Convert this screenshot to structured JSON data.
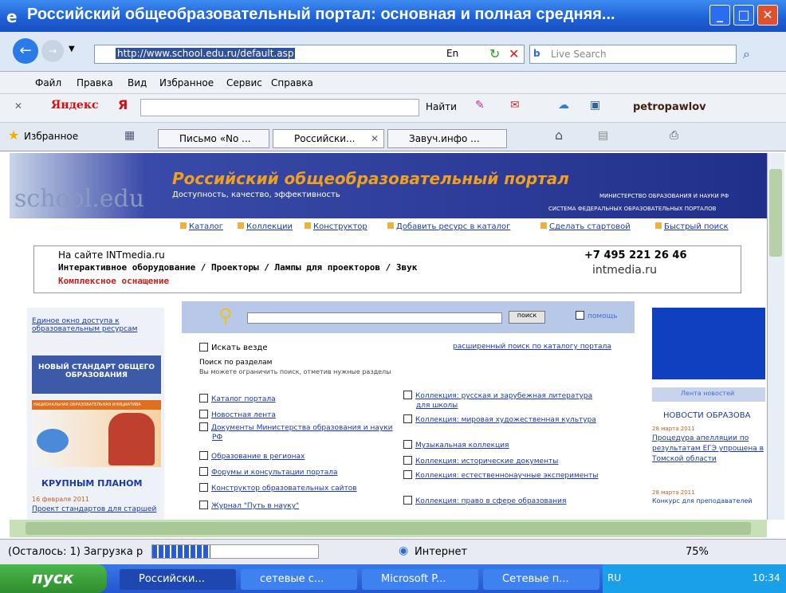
{
  "window": {
    "title": "Российский общеобразовательный портал: основная и полная средняя..."
  },
  "nav": {
    "url": "http://www.school.edu.ru/default.asp",
    "search_placeholder": "Live Search",
    "lang": "En"
  },
  "menu": [
    "Файл",
    "Правка",
    "Вид",
    "Избранное",
    "Сервис",
    "Справка"
  ],
  "yandex": {
    "logo": "Яндекс",
    "find": "Найти",
    "user": "petropawlov"
  },
  "tabs": {
    "favorites": "Избранное",
    "items": [
      "Письмо «No ...",
      "Российски...",
      "Завуч.инфо ..."
    ]
  },
  "banner": {
    "title": "Российский общеобразовательный портал",
    "subtitle": "Доступность, качество, эффективность",
    "ministry": "МИНИСТЕРСТВО ОБРАЗОВАНИЯ И НАУКИ РФ",
    "system": "СИСТЕМА ФЕДЕРАЛЬНЫХ ОБРАЗОВАТЕЛЬНЫХ ПОРТАЛОВ",
    "watermark": "school.edu"
  },
  "toplinks": [
    "Каталог",
    "Коллекции",
    "Конструктор",
    "Добавить ресурс в каталог",
    "Сделать стартовой",
    "Быстрый поиск"
  ],
  "ad": {
    "line1": "На сайте INTmedia.ru",
    "line2": "Интерактивное оборудование / Проекторы / Лампы для проекторов / Звук",
    "line3": "Комплексное оснащение",
    "phone": "+7 495 221 26 46",
    "brand": "intmedia.ru"
  },
  "left": {
    "link": "Единое окно доступа к образовательным ресурсам",
    "standard": "НОВЫЙ СТАНДАРТ ОБЩЕГО ОБРАЗОВАНИЯ",
    "strip": "НАЦИОНАЛЬНАЯ ОБРАЗОВАТЕЛЬНАЯ ИНИЦИАТИВА",
    "closeup": "КРУПНЫМ ПЛАНОМ",
    "date": "16 февраля 2011",
    "text": "Проект стандартов для старшей"
  },
  "searchbox": {
    "button": "поиск",
    "help": "помощь",
    "search_all": "Искать везде",
    "advanced": "расширенный поиск по каталогу портала",
    "heading": "Поиск по разделам",
    "hint": "Вы можете ограничить поиск, отметив нужные разделы"
  },
  "sections_left": [
    "Каталог портала",
    "Новостная лента",
    "Документы Министерства образования и науки РФ",
    "Образование в регионах",
    "Форумы и консультации портала",
    "Конструктор образовательных сайтов",
    "Журнал \"Путь в науку\""
  ],
  "sections_right": [
    "Коллекция: русская и зарубежная литература для школы",
    "Коллекция: мировая художественная культура",
    "Музыкальная коллекция",
    "Коллекция: исторические документы",
    "Коллекция: естественнонаучные эксперименты",
    "Коллекция: право в сфере образования"
  ],
  "right": {
    "all_news": "Лента новостей",
    "news_title": "НОВОСТИ ОБРАЗОВА",
    "date1": "28 марта 2011",
    "news1": "Процедура апелляции по результатам ЕГЭ упрощена в Томской области",
    "date2": "28 марта 2011",
    "news2": "Конкурс для преподавателей"
  },
  "status": {
    "text": "(Осталось: 1) Загрузка р",
    "zone": "Интернет",
    "zoom": "75%",
    "progress": 0.35
  },
  "taskbar": {
    "start": "пуск",
    "items": [
      "Российски...",
      "сетевые с...",
      "Microsoft P...",
      "Сетевые п..."
    ],
    "lang": "RU",
    "clock": "10:34"
  }
}
